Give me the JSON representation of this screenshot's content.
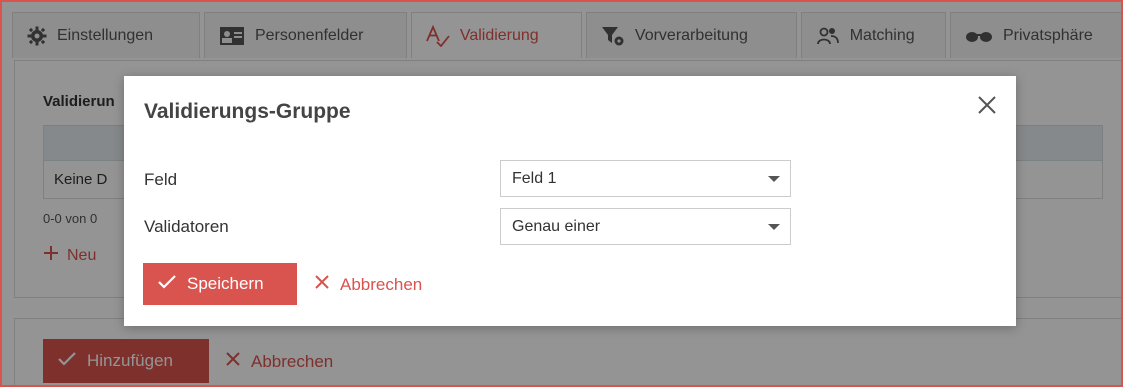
{
  "tabs": [
    {
      "label": "Einstellungen",
      "icon": "gear-icon",
      "active": false
    },
    {
      "label": "Personenfelder",
      "icon": "id-card-icon",
      "active": false
    },
    {
      "label": "Validierung",
      "icon": "spellcheck-icon",
      "active": true
    },
    {
      "label": "Vorverarbeitung",
      "icon": "filter-gear-icon",
      "active": false
    },
    {
      "label": "Matching",
      "icon": "users-icon",
      "active": false
    },
    {
      "label": "Privatsphäre",
      "icon": "glasses-icon",
      "active": false
    }
  ],
  "background": {
    "panel_title": "Validierun",
    "table_empty_text": "Keine D",
    "pager_text": "0-0 von 0",
    "new_link": "Neu",
    "add_button": "Hinzufügen",
    "cancel_link": "Abbrechen"
  },
  "modal": {
    "title": "Validierungs-Gruppe",
    "fields": [
      {
        "label": "Feld",
        "value": "Feld 1"
      },
      {
        "label": "Validatoren",
        "value": "Genau einer"
      }
    ],
    "save_button": "Speichern",
    "cancel_link": "Abbrechen"
  },
  "colors": {
    "accent": "#d9534f",
    "overlay": "rgba(0,0,0,0.42)"
  }
}
